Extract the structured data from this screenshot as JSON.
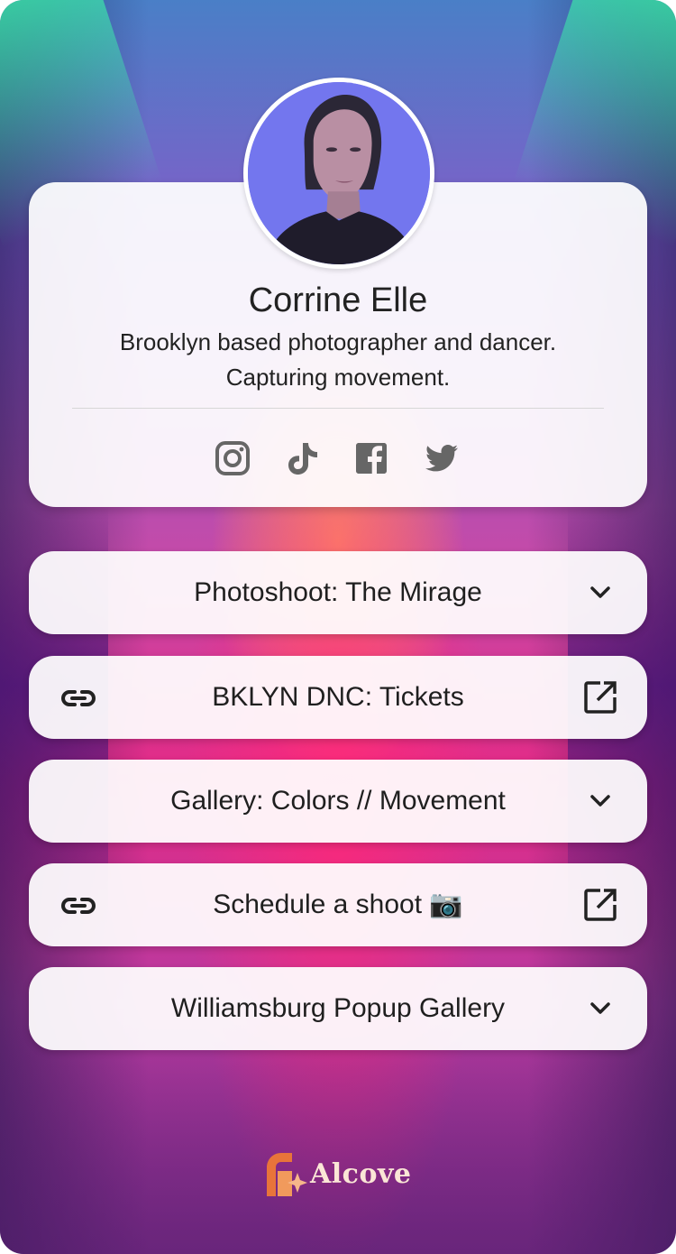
{
  "profile": {
    "name": "Corrine Elle",
    "bio_line1": "Brooklyn based photographer and dancer.",
    "bio_line2": "Capturing movement."
  },
  "socials": [
    {
      "icon": "instagram-icon"
    },
    {
      "icon": "tiktok-icon"
    },
    {
      "icon": "facebook-icon"
    },
    {
      "icon": "twitter-icon"
    }
  ],
  "links": [
    {
      "label": "Photoshoot: The Mirage",
      "left_icon": "",
      "right_icon": "chevron-down-icon"
    },
    {
      "label": "BKLYN DNC: Tickets",
      "left_icon": "link-icon",
      "right_icon": "external-link-icon"
    },
    {
      "label": "Gallery: Colors // Movement",
      "left_icon": "",
      "right_icon": "chevron-down-icon"
    },
    {
      "label": "Schedule a shoot 📷",
      "left_icon": "link-icon",
      "right_icon": "external-link-icon"
    },
    {
      "label": "Williamsburg Popup Gallery",
      "left_icon": "",
      "right_icon": "chevron-down-icon"
    }
  ],
  "footer": {
    "brand": "Alcove"
  },
  "colors": {
    "card_bg": "#ffffff",
    "text": "#222222",
    "icon_gray": "#666666",
    "brand_orange": "#e8743a",
    "brand_text": "#fbe6d6"
  }
}
